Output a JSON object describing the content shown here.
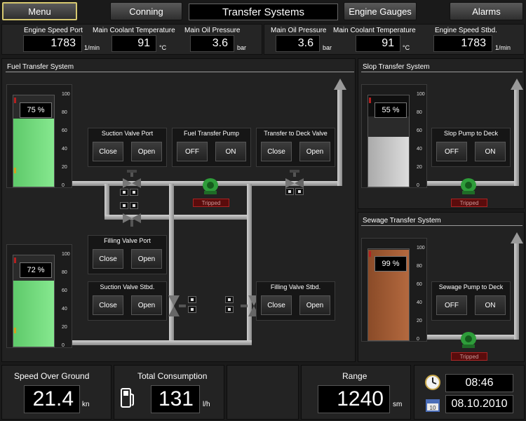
{
  "nav": {
    "menu": "Menu",
    "conning": "Conning",
    "title": "Transfer Systems",
    "engine_gauges": "Engine Gauges",
    "alarms": "Alarms"
  },
  "header_left": [
    {
      "label": "Engine Speed Port",
      "value": "1783",
      "unit": "1/min"
    },
    {
      "label": "Main Coolant Temperature",
      "value": "91",
      "unit": "°C"
    },
    {
      "label": "Main Oil Pressure",
      "value": "3.6",
      "unit": "bar"
    }
  ],
  "header_right": [
    {
      "label": "Main Oil Pressure",
      "value": "3.6",
      "unit": "bar"
    },
    {
      "label": "Main Coolant Temperature",
      "value": "91",
      "unit": "°C"
    },
    {
      "label": "Engine Speed Stbd.",
      "value": "1783",
      "unit": "1/min"
    }
  ],
  "fuel": {
    "title": "Fuel Transfer System",
    "tank_port": {
      "level": 75,
      "label": "75 %"
    },
    "tank_stbd": {
      "level": 72,
      "label": "72 %"
    },
    "suction_port": {
      "title": "Suction Valve Port",
      "a": "Close",
      "b": "Open"
    },
    "pump": {
      "title": "Fuel Transfer Pump",
      "a": "OFF",
      "b": "ON"
    },
    "deck_valve": {
      "title": "Transfer to Deck Valve",
      "a": "Close",
      "b": "Open"
    },
    "filling_port": {
      "title": "Filling Valve Port",
      "a": "Close",
      "b": "Open"
    },
    "suction_stbd": {
      "title": "Suction Valve Stbd.",
      "a": "Close",
      "b": "Open"
    },
    "filling_stbd": {
      "title": "Filling Valve Stbd.",
      "a": "Close",
      "b": "Open"
    },
    "tripped": "Tripped"
  },
  "slop": {
    "title": "Slop Transfer System",
    "tank": {
      "level": 55,
      "label": "55 %"
    },
    "pump": {
      "title": "Slop Pump to Deck",
      "a": "OFF",
      "b": "ON"
    },
    "tripped": "Tripped"
  },
  "sewage": {
    "title": "Sewage Transfer System",
    "tank": {
      "level": 99,
      "label": "99 %"
    },
    "pump": {
      "title": "Sewage Pump to Deck",
      "a": "OFF",
      "b": "ON"
    },
    "tripped": "Tripped"
  },
  "scale": [
    "100",
    "80",
    "60",
    "40",
    "20",
    "0"
  ],
  "bottom": {
    "sog_label": "Speed Over Ground",
    "sog_value": "21.4",
    "sog_unit": "kn",
    "cons_label": "Total Consumption",
    "cons_value": "131",
    "cons_unit": "l/h",
    "range_label": "Range",
    "range_value": "1240",
    "range_unit": "sm",
    "time": "08:46",
    "date": "08.10.2010",
    "calendar_day": "10"
  },
  "colors": {
    "fuel": "#6fdc7a",
    "slop": "#c9c9c9",
    "sewage": "#9c5a34",
    "pump": "#2e9d3a"
  }
}
